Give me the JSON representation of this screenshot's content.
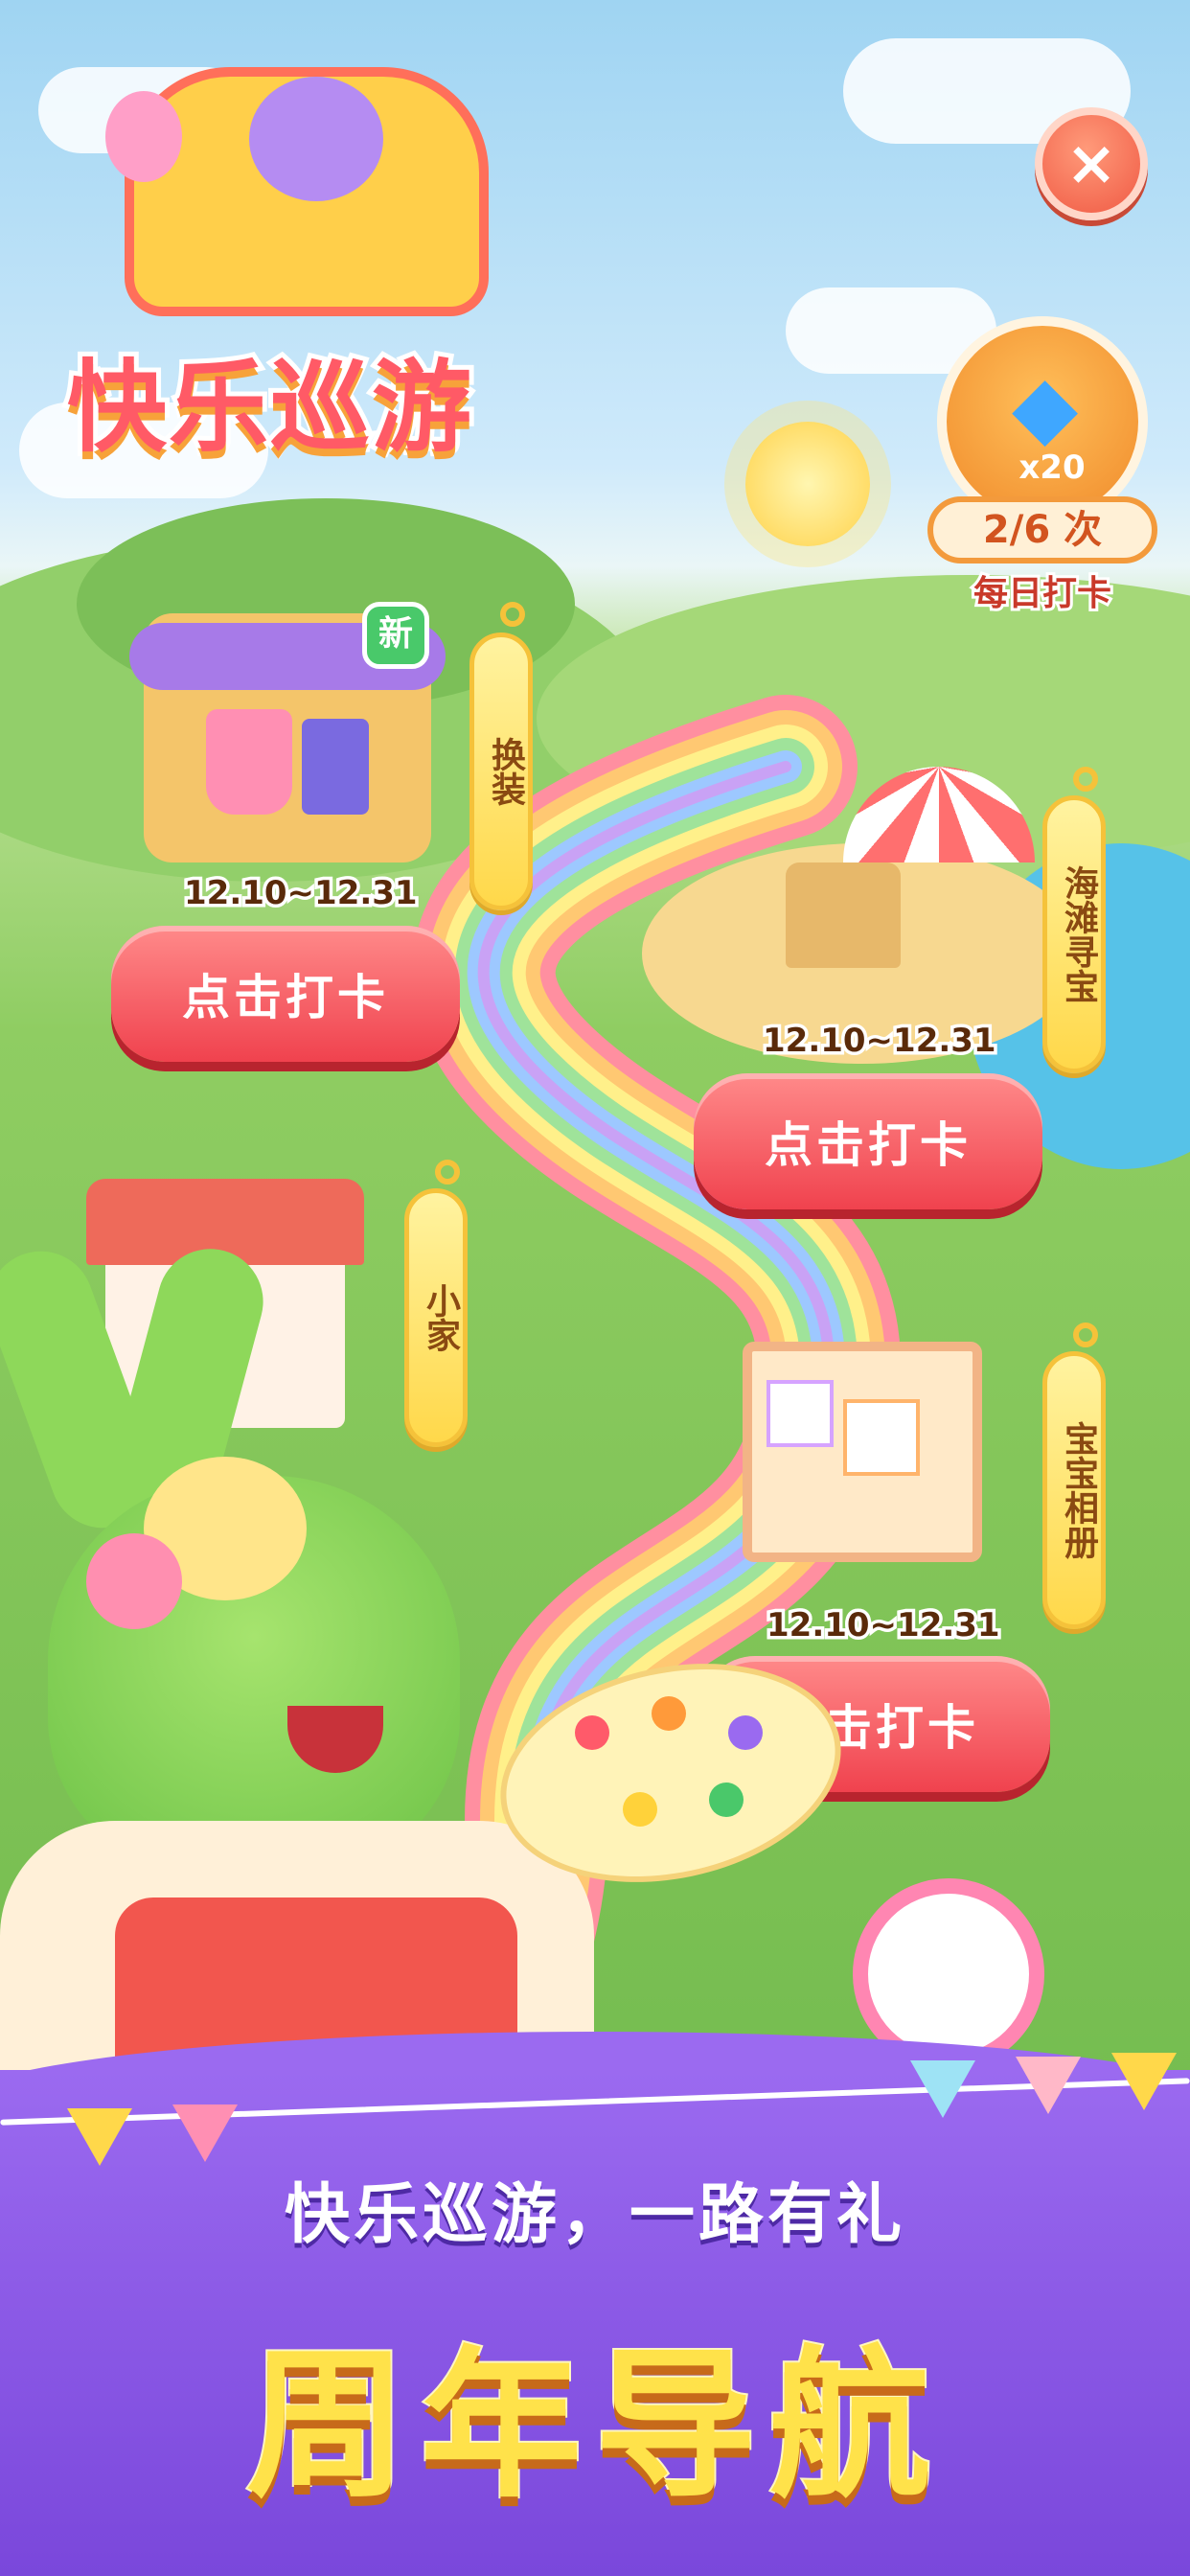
{
  "logo": {
    "title": "快乐巡游"
  },
  "close_button": {
    "icon": "close-icon",
    "label": "×"
  },
  "daily_checkin": {
    "reward_icon": "diamond-icon",
    "reward_count": "x20",
    "progress": "2/6 次",
    "label": "每日打卡"
  },
  "stations": [
    {
      "name": "换装",
      "new_badge": "新",
      "date": "12.10~12.31",
      "button": "点击打卡"
    },
    {
      "name": "海滩寻宝",
      "date": "12.10~12.31",
      "button": "点击打卡"
    },
    {
      "name": "小家"
    },
    {
      "name": "宝宝相册",
      "date": "12.10~12.31",
      "button": "点击打卡"
    }
  ],
  "banner": {
    "slogan": "快乐巡游，一路有礼",
    "headline": "周年导航"
  },
  "colors": {
    "button": "#f0424e",
    "tag": "#ffd84a",
    "banner": "#8755e4",
    "headline": "#ffe24a"
  }
}
